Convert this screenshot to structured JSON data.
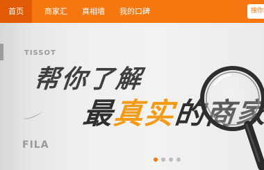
{
  "nav": {
    "items": [
      {
        "label": "首页",
        "active": true
      },
      {
        "label": "商家汇",
        "active": false
      },
      {
        "label": "真相墙",
        "active": false
      },
      {
        "label": "我的口碑",
        "active": false
      }
    ],
    "search_label": "搜你想"
  },
  "banner": {
    "brands": [
      "TISSOT",
      "FILA"
    ],
    "headline_line1": "帮你了解",
    "headline_line2_prefix": "最",
    "headline_line2_highlight": "真实",
    "headline_line2_suffix": "的商家",
    "slides": {
      "count": 4,
      "active_index": 0
    }
  },
  "colors": {
    "accent": "#f6770f",
    "accent_dark": "#e25a05",
    "highlight": "#f39a16",
    "headline": "#2f2f2f"
  },
  "icons": [
    "magnifier-glass-icon",
    "nike-swoosh-icon"
  ]
}
